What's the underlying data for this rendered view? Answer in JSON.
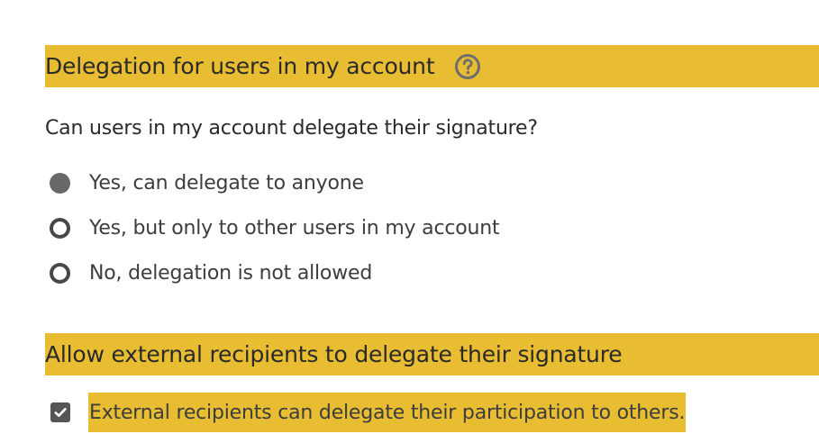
{
  "delegation_section": {
    "title": "Delegation for users in my account",
    "help_icon": "question-circle-icon"
  },
  "delegation_question": {
    "text": "Can users in my account delegate their signature?"
  },
  "delegation_options": [
    {
      "label": "Yes, can delegate to anyone",
      "selected": true
    },
    {
      "label": "Yes, but only to other users in my account",
      "selected": false
    },
    {
      "label": "No, delegation is not allowed",
      "selected": false
    }
  ],
  "external_section": {
    "title": "Allow external recipients to delegate their signature"
  },
  "external_checkbox": {
    "label": "External recipients can delegate their participation to others.",
    "checked": true
  },
  "colors": {
    "highlight": "#e8bd32",
    "text": "#2a2a2a",
    "control": "#555555",
    "selected_radio": "#686868"
  }
}
